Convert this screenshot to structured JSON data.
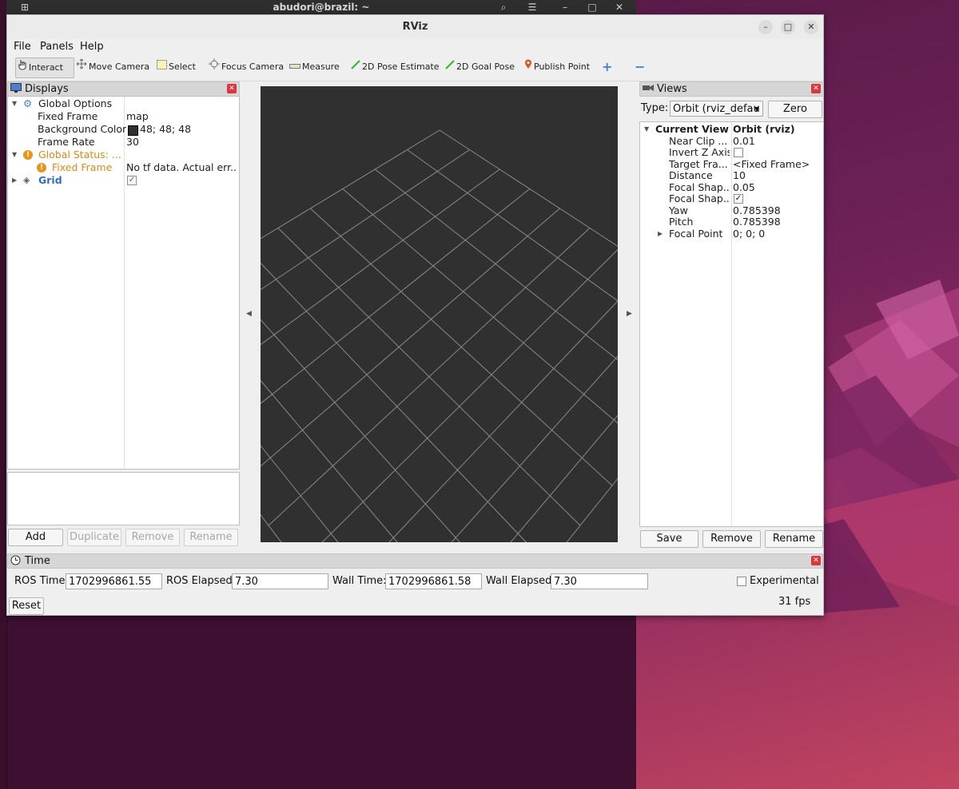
{
  "desktop": {
    "terminal_title": "abudori@brazil: ~"
  },
  "window": {
    "title": "RViz"
  },
  "menu": [
    "File",
    "Panels",
    "Help"
  ],
  "toolbar": {
    "tools": [
      "Interact",
      "Move Camera",
      "Select",
      "Focus Camera",
      "Measure",
      "2D Pose Estimate",
      "2D Goal Pose",
      "Publish Point"
    ],
    "add_icon": "+",
    "remove_icon": "−"
  },
  "displays": {
    "title": "Displays",
    "global_options": "Global Options",
    "fixed_frame_label": "Fixed Frame",
    "fixed_frame_value": "map",
    "bg_color_label": "Background Color",
    "bg_color_value": "48; 48; 48",
    "frame_rate_label": "Frame Rate",
    "frame_rate_value": "30",
    "global_status_label": "Global Status: ...",
    "status_fixed_frame_label": "Fixed Frame",
    "status_fixed_frame_value": "No tf data.  Actual err...",
    "grid_label": "Grid",
    "buttons": {
      "add": "Add",
      "duplicate": "Duplicate",
      "remove": "Remove",
      "rename": "Rename"
    },
    "colors": {
      "warning": "#d98a17",
      "grid_link": "#2f6fc0",
      "bg_swatch": "#303030"
    }
  },
  "views": {
    "title": "Views",
    "type_label": "Type:",
    "type_value": "Orbit (rviz_defau",
    "zero_button": "Zero",
    "current_view_label": "Current View",
    "current_view_value": "Orbit (rviz)",
    "props": [
      {
        "k": "Near Clip ...",
        "v": "0.01"
      },
      {
        "k": "Invert Z Axis",
        "v": ""
      },
      {
        "k": "Target Fra...",
        "v": "<Fixed Frame>"
      },
      {
        "k": "Distance",
        "v": "10"
      },
      {
        "k": "Focal Shap...",
        "v": "0.05"
      },
      {
        "k": "Focal Shap...",
        "v": ""
      },
      {
        "k": "Yaw",
        "v": "0.785398"
      },
      {
        "k": "Pitch",
        "v": "0.785398"
      },
      {
        "k": "Focal Point",
        "v": "0; 0; 0"
      }
    ],
    "buttons": {
      "save": "Save",
      "remove": "Remove",
      "rename": "Rename"
    }
  },
  "time": {
    "title": "Time",
    "ros_time_label": "ROS Time:",
    "ros_time_value": "1702996861.55",
    "ros_elapsed_label": "ROS Elapsed:",
    "ros_elapsed_value": "7.30",
    "wall_time_label": "Wall Time:",
    "wall_time_value": "1702996861.58",
    "wall_elapsed_label": "Wall Elapsed:",
    "wall_elapsed_value": "7.30",
    "experimental_label": "Experimental",
    "reset_button": "Reset",
    "fps": "31 fps"
  }
}
